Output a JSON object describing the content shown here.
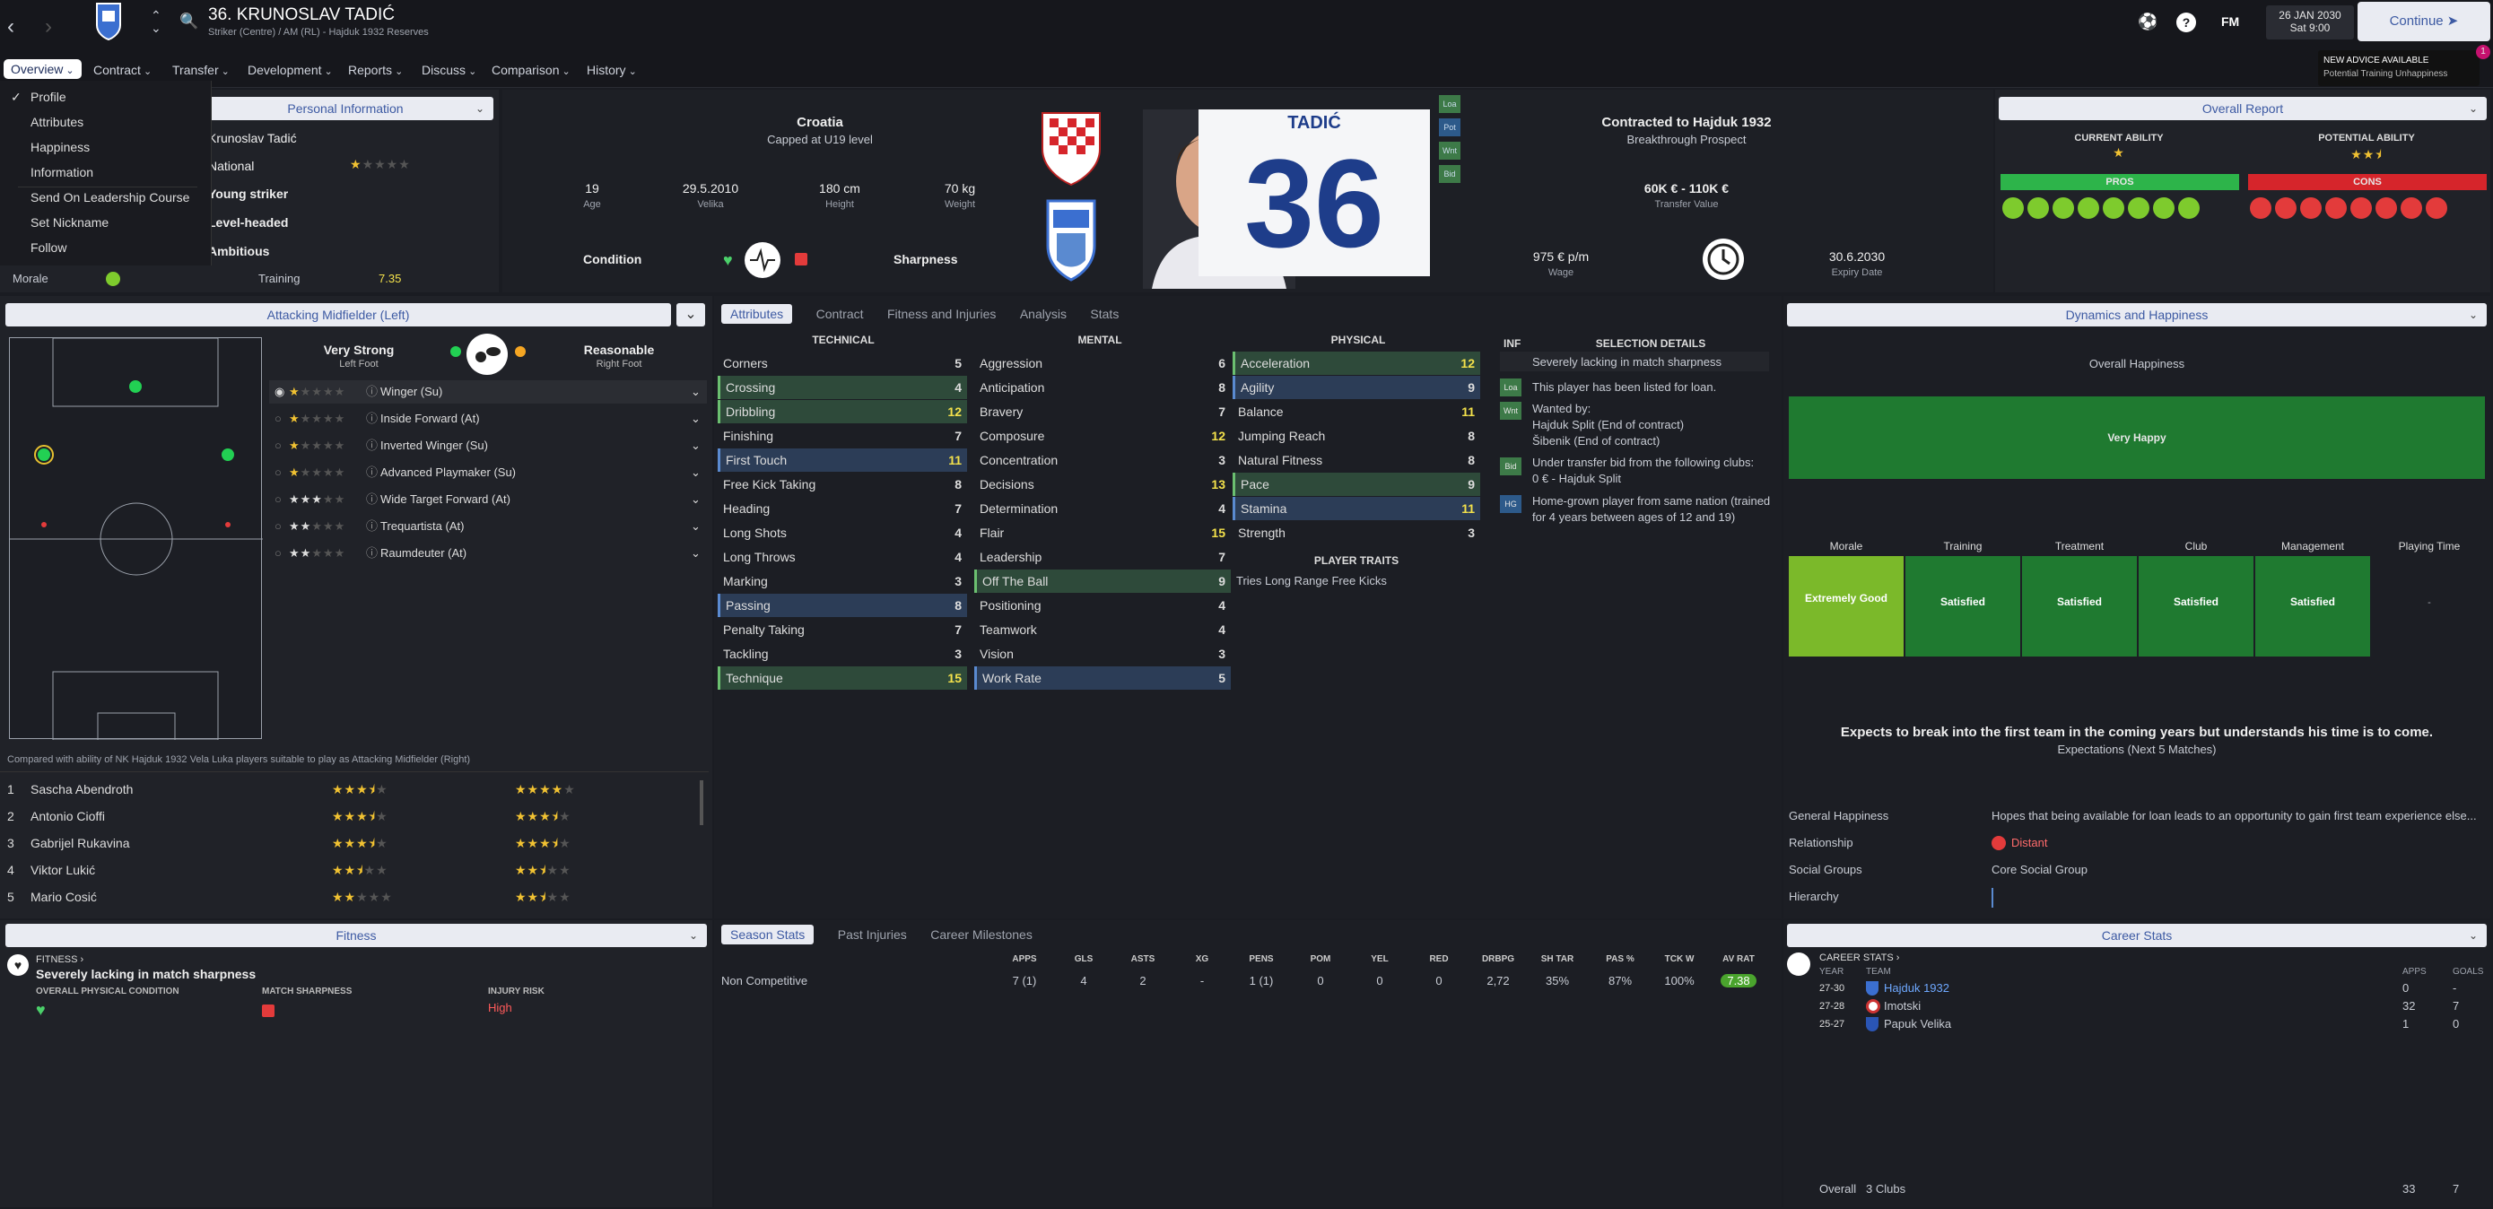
{
  "topbar": {
    "player_title": "36. KRUNOSLAV TADIĆ",
    "player_subtitle": "Striker (Centre) / AM (RL) - Hajduk 1932 Reserves",
    "fm_label": "FM",
    "date_line1": "26 JAN 2030",
    "date_line2": "Sat 9:00",
    "continue_label": "Continue",
    "advice_title": "NEW ADVICE AVAILABLE",
    "advice_text": "Potential Training Unhappiness",
    "advice_badge": "1"
  },
  "menu": [
    "Overview",
    "Contract",
    "Transfer",
    "Development",
    "Reports",
    "Discuss",
    "Comparison",
    "History"
  ],
  "overview_dropdown": [
    "Profile",
    "Attributes",
    "Happiness",
    "Information",
    "Send On Leadership Course",
    "Set Nickname",
    "Follow"
  ],
  "personal": {
    "header": "Personal Information",
    "rows": [
      "Krunoslav Tadić",
      "National",
      "Young striker",
      "Level-headed",
      "Ambitious"
    ],
    "morale_label": "Morale",
    "training_label": "Training",
    "training_value": "7.35"
  },
  "profile": {
    "nation": "Croatia",
    "caps": "Capped at U19 level",
    "age_value": "19",
    "age_label": "Age",
    "dob": "29.5.2010",
    "pob": "Velika",
    "height": "180 cm",
    "height_label": "Height",
    "weight": "70 kg",
    "weight_label": "Weight",
    "condition_label": "Condition",
    "sharpness_label": "Sharpness",
    "shirt_name": "TADIĆ",
    "shirt_number": "36",
    "contract_title": "Contracted to Hajduk 1932",
    "contract_sub": "Breakthrough Prospect",
    "transfer_value": "60K € - 110K €",
    "transfer_value_label": "Transfer Value",
    "wage": "975 € p/m",
    "wage_label": "Wage",
    "expiry": "30.6.2030",
    "expiry_label": "Expiry Date",
    "side_tags": [
      "Loa",
      "Pot",
      "Wnt",
      "Bid"
    ]
  },
  "overall_report": {
    "header": "Overall Report",
    "current_label": "CURRENT ABILITY",
    "potential_label": "POTENTIAL ABILITY",
    "current_stars": 1,
    "potential_stars": 2.5,
    "pros_label": "PROS",
    "cons_label": "CONS"
  },
  "position": {
    "header": "Attacking Midfielder (Left)",
    "left_foot_rating": "Very Strong",
    "left_foot": "Left Foot",
    "right_foot_rating": "Reasonable",
    "right_foot": "Right Foot",
    "roles": [
      {
        "name": "Winger (Su)",
        "stars": 1
      },
      {
        "name": "Inside Forward (At)",
        "stars": 1
      },
      {
        "name": "Inverted Winger (Su)",
        "stars": 1
      },
      {
        "name": "Advanced Playmaker (Su)",
        "stars": 1
      },
      {
        "name": "Wide Target Forward (At)",
        "stars": 3
      },
      {
        "name": "Trequartista (At)",
        "stars": 2
      },
      {
        "name": "Raumdeuter (At)",
        "stars": 2
      }
    ]
  },
  "compare": {
    "caption": "Compared with ability of NK Hajduk 1932 Vela Luka players suitable to play as Attacking Midfielder (Right)",
    "players": [
      {
        "num": "1",
        "name": "Sascha Abendroth",
        "a": 3.5,
        "b": 4
      },
      {
        "num": "2",
        "name": "Antonio Cioffi",
        "a": 3.5,
        "b": 3.5
      },
      {
        "num": "3",
        "name": "Gabrijel Rukavina",
        "a": 3.5,
        "b": 3.5
      },
      {
        "num": "4",
        "name": "Viktor Lukić",
        "a": 2.5,
        "b": 2.5
      },
      {
        "num": "5",
        "name": "Mario Cosić",
        "a": 2,
        "b": 2.5
      }
    ]
  },
  "attr_tabs": [
    "Attributes",
    "Contract",
    "Fitness and Injuries",
    "Analysis",
    "Stats"
  ],
  "technical_header": "TECHNICAL",
  "mental_header": "MENTAL",
  "physical_header": "PHYSICAL",
  "technical": [
    [
      "Corners",
      "5",
      ""
    ],
    [
      "Crossing",
      "4",
      "g"
    ],
    [
      "Dribbling",
      "12",
      "g"
    ],
    [
      "Finishing",
      "7",
      ""
    ],
    [
      "First Touch",
      "11",
      "b"
    ],
    [
      "Free Kick Taking",
      "8",
      ""
    ],
    [
      "Heading",
      "7",
      ""
    ],
    [
      "Long Shots",
      "4",
      ""
    ],
    [
      "Long Throws",
      "4",
      ""
    ],
    [
      "Marking",
      "3",
      ""
    ],
    [
      "Passing",
      "8",
      "b"
    ],
    [
      "Penalty Taking",
      "7",
      ""
    ],
    [
      "Tackling",
      "3",
      ""
    ],
    [
      "Technique",
      "15",
      "g"
    ]
  ],
  "mental": [
    [
      "Aggression",
      "6",
      ""
    ],
    [
      "Anticipation",
      "8",
      ""
    ],
    [
      "Bravery",
      "7",
      ""
    ],
    [
      "Composure",
      "12",
      ""
    ],
    [
      "Concentration",
      "3",
      ""
    ],
    [
      "Decisions",
      "13",
      ""
    ],
    [
      "Determination",
      "4",
      ""
    ],
    [
      "Flair",
      "15",
      ""
    ],
    [
      "Leadership",
      "7",
      ""
    ],
    [
      "Off The Ball",
      "9",
      "g"
    ],
    [
      "Positioning",
      "4",
      ""
    ],
    [
      "Teamwork",
      "4",
      ""
    ],
    [
      "Vision",
      "3",
      ""
    ],
    [
      "Work Rate",
      "5",
      "b"
    ]
  ],
  "physical": [
    [
      "Acceleration",
      "12",
      "g"
    ],
    [
      "Agility",
      "9",
      "b"
    ],
    [
      "Balance",
      "11",
      ""
    ],
    [
      "Jumping Reach",
      "8",
      ""
    ],
    [
      "Natural Fitness",
      "8",
      ""
    ],
    [
      "Pace",
      "9",
      "g"
    ],
    [
      "Stamina",
      "11",
      "b"
    ],
    [
      "Strength",
      "3",
      ""
    ]
  ],
  "traits_header": "PLAYER TRAITS",
  "traits": [
    "Tries Long Range Free Kicks"
  ],
  "selection": {
    "inf_label": "INF",
    "header": "SELECTION DETAILS",
    "items": [
      "Severely lacking in match sharpness",
      "This player has been listed for loan.",
      "Wanted by:",
      "Hajduk Split (End of contract)",
      "Šibenik (End of contract)",
      "Under transfer bid from the following clubs:",
      "0 € - Hajduk Split",
      "Home-grown player from same nation (trained for 4 years between ages of 12 and 19)"
    ],
    "tags": [
      "Loa",
      "Wnt",
      "Bid",
      "HG"
    ]
  },
  "dynamics": {
    "header": "Dynamics and Happiness",
    "overall_label": "Overall Happiness",
    "overall_value": "Very Happy",
    "categories": [
      "Morale",
      "Training",
      "Treatment",
      "Club",
      "Management",
      "Playing Time"
    ],
    "values": [
      "Extremely Good",
      "Satisfied",
      "Satisfied",
      "Satisfied",
      "Satisfied",
      "-"
    ],
    "expect_title": "Expects to break into the first team in the coming years but understands his time is to come.",
    "expect_sub": "Expectations (Next 5 Matches)",
    "rows": [
      [
        "General Happiness",
        "Hopes that being available for loan leads to an opportunity to gain first team experience else..."
      ],
      [
        "Relationship",
        "Distant"
      ],
      [
        "Social Groups",
        "Core Social Group"
      ],
      [
        "Hierarchy",
        ""
      ]
    ]
  },
  "fitness": {
    "header": "Fitness",
    "link": "FITNESS",
    "status": "Severely lacking in match sharpness",
    "overall_label": "OVERALL PHYSICAL CONDITION",
    "sharpness_label": "MATCH SHARPNESS",
    "injury_label": "INJURY RISK",
    "injury_value": "High"
  },
  "season_tabs": [
    "Season Stats",
    "Past Injuries",
    "Career Milestones"
  ],
  "season_stats": {
    "headers": [
      "APPS",
      "GLS",
      "ASTS",
      "XG",
      "PENS",
      "POM",
      "YEL",
      "RED",
      "DRBPG",
      "SH TAR",
      "PAS %",
      "TCK W",
      "AV RAT"
    ],
    "row_label": "Non Competitive",
    "values": [
      "7 (1)",
      "4",
      "2",
      "-",
      "1 (1)",
      "0",
      "0",
      "0",
      "2,72",
      "35%",
      "87%",
      "100%",
      "7.38"
    ]
  },
  "career": {
    "header": "Career Stats",
    "link": "CAREER STATS",
    "year_label": "YEAR",
    "team_label": "TEAM",
    "apps_label": "APPS",
    "goals_label": "GOALS",
    "rows": [
      [
        "27-30",
        "Hajduk 1932",
        "0",
        "-"
      ],
      [
        "27-28",
        "Imotski",
        "32",
        "7"
      ],
      [
        "25-27",
        "Papuk Velika",
        "1",
        "0"
      ]
    ],
    "overall_label": "Overall",
    "overall_clubs": "3 Clubs",
    "overall_apps": "33",
    "overall_goals": "7"
  },
  "colors": {
    "accent": "#3d5aa3",
    "pros": "#2db44a",
    "cons": "#d6252b",
    "happy": "#1f7a30",
    "pitch_line": "#9aa0aa"
  }
}
